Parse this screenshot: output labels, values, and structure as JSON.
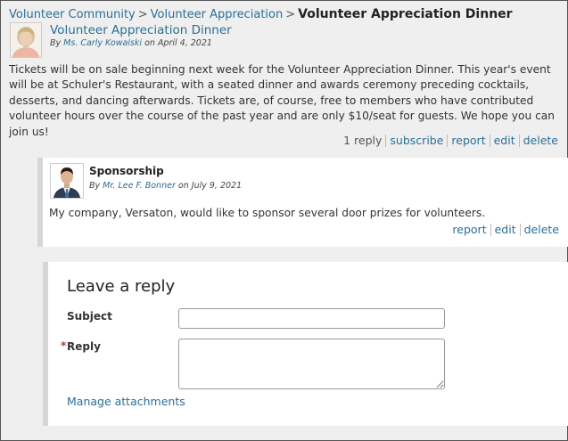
{
  "breadcrumb": {
    "items": [
      "Volunteer Community",
      "Volunteer Appreciation"
    ],
    "separator": ">",
    "current": "Volunteer Appreciation Dinner"
  },
  "post": {
    "title": "Volunteer Appreciation Dinner",
    "by_prefix": "By",
    "author": "Ms. Carly Kowalski",
    "date_prefix": "on",
    "date": "April 4, 2021",
    "body": "Tickets will be on sale beginning next week for the Volunteer Appreciation Dinner. This year's event will be at Schuler's Restaurant, with a seated dinner and awards ceremony preceding cocktails, desserts, and dancing afterwards. Tickets are, of course, free to members who have contributed volunteer hours over the course of the past year and are only $10/seat for guests. We hope you can join us!",
    "reply_count": "1 reply",
    "actions": {
      "subscribe": "subscribe",
      "report": "report",
      "edit": "edit",
      "delete": "delete"
    }
  },
  "reply": {
    "title": "Sponsorship",
    "by_prefix": "By",
    "author": "Mr. Lee F. Bonner",
    "date_prefix": "on",
    "date": "July 9, 2021",
    "body": "My company, Versaton, would like to sponsor several door prizes for volunteers.",
    "actions": {
      "report": "report",
      "edit": "edit",
      "delete": "delete"
    }
  },
  "form": {
    "heading": "Leave a reply",
    "subject_label": "Subject",
    "subject_value": "",
    "required_marker": "*",
    "reply_label": "Reply",
    "reply_value": "",
    "manage_attachments": "Manage attachments"
  },
  "colors": {
    "link": "#2a6f97",
    "background": "#efefef",
    "card": "#ffffff",
    "required": "#c0392b"
  }
}
